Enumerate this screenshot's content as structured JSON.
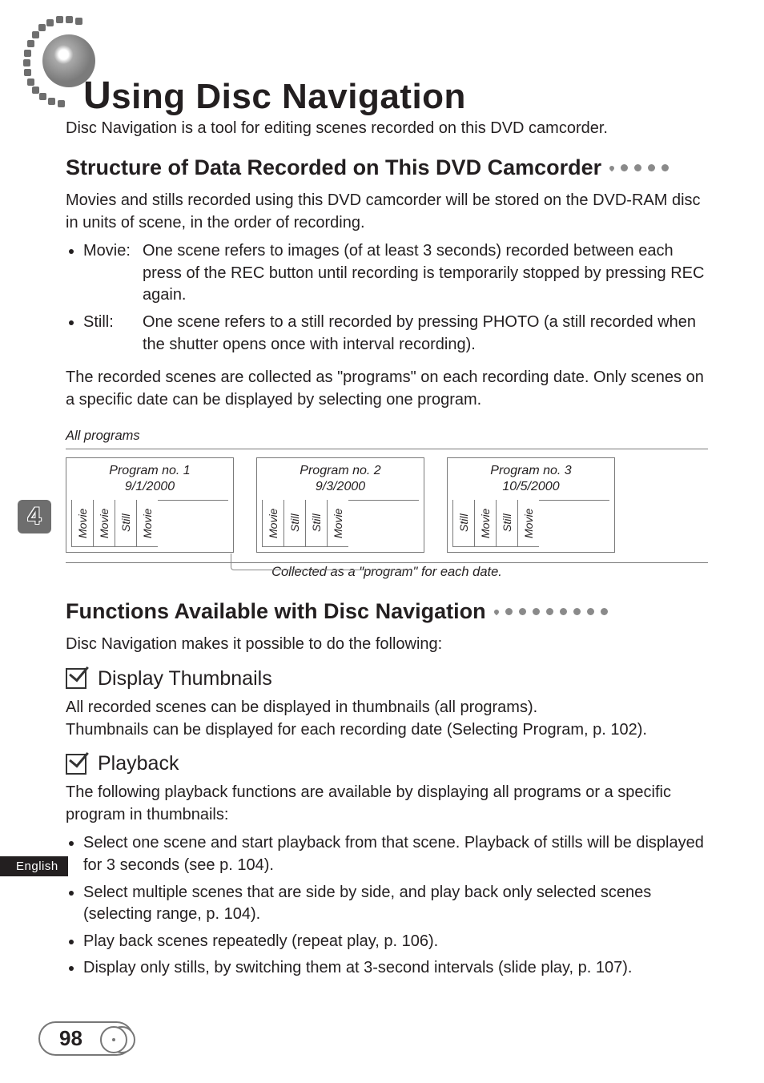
{
  "chapter_marker": "4",
  "side_tab": "English",
  "page_number": "98",
  "chapter_title": {
    "cap": "U",
    "rest": "sing Disc Navigation"
  },
  "intro": "Disc Navigation is a tool for editing scenes recorded on this DVD camcorder.",
  "section1": {
    "heading": "Structure of Data Recorded on This DVD Camcorder",
    "para1": "Movies and stills recorded using this DVD camcorder will be stored on the DVD-RAM disc in units of scene, in the order of recording.",
    "bullets": [
      {
        "label": "Movie:",
        "text": "One scene refers to images (of at least 3 seconds) recorded between each press of the REC button until recording is temporarily stopped by pressing REC again."
      },
      {
        "label": "Still:",
        "text": "One scene refers to a still recorded by pressing PHOTO (a still recorded when the shutter opens once with interval recording)."
      }
    ],
    "para2": "The recorded scenes are collected as \"programs\" on each recording date. Only scenes on a specific date can be displayed by selecting one program.",
    "diagram_caption": "All programs",
    "programs": [
      {
        "title": "Program no. 1",
        "date": "9/1/2000",
        "scenes": [
          "Movie",
          "Movie",
          "Still",
          "Movie",
          ""
        ]
      },
      {
        "title": "Program no. 2",
        "date": "9/3/2000",
        "scenes": [
          "Movie",
          "Still",
          "Still",
          "Movie",
          ""
        ]
      },
      {
        "title": "Program no. 3",
        "date": "10/5/2000",
        "scenes": [
          "Still",
          "Movie",
          "Still",
          "Movie",
          ""
        ]
      }
    ],
    "diagram_note": "Collected as a \"program\" for each date."
  },
  "section2": {
    "heading": "Functions Available with Disc Navigation",
    "intro": "Disc Navigation makes it possible to do the following:",
    "sub1": {
      "heading": "Display Thumbnails",
      "line1": "All recorded scenes can be displayed in thumbnails (all programs).",
      "line2": "Thumbnails can be displayed for each recording date (Selecting Program, p. 102)."
    },
    "sub2": {
      "heading": "Playback",
      "intro": "The following playback functions are available by displaying all programs or a specific program in thumbnails:",
      "bullets": [
        "Select one scene and start playback from that scene. Playback of stills will be displayed for 3 seconds (see p. 104).",
        "Select multiple scenes that are side by side, and play back only selected scenes (selecting range, p. 104).",
        "Play back scenes repeatedly (repeat play, p. 106).",
        "Display only stills, by switching them at 3-second intervals (slide play, p. 107)."
      ]
    }
  }
}
